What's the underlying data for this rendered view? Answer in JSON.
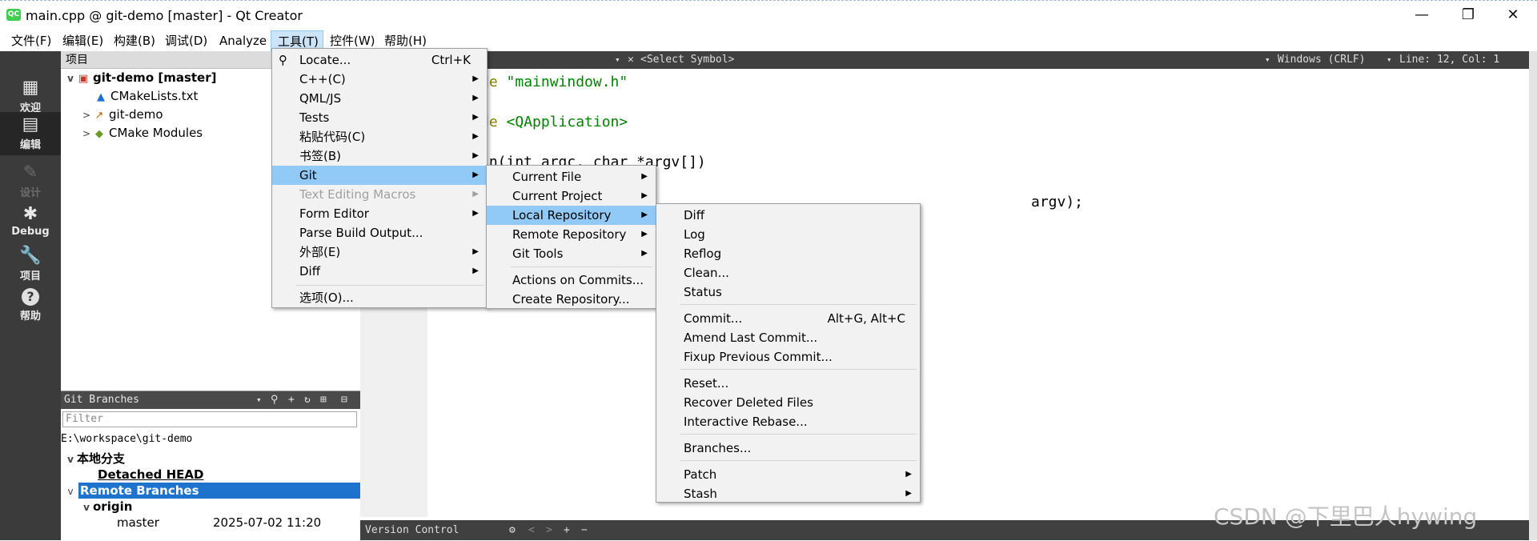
{
  "window": {
    "title": "main.cpp @ git-demo [master] - Qt Creator",
    "app_icon_text": "QC",
    "minimize": "—",
    "maximize": "❐",
    "close": "✕"
  },
  "menubar": [
    "文件(F)",
    "编辑(E)",
    "构建(B)",
    "调试(D)",
    "Analyze",
    "工具(T)",
    "控件(W)",
    "帮助(H)"
  ],
  "modes": [
    {
      "label": "欢迎",
      "icon": "grid-icon",
      "glyph": "▦"
    },
    {
      "label": "编辑",
      "icon": "edit-icon",
      "glyph": "▤"
    },
    {
      "label": "设计",
      "icon": "pencil-icon",
      "glyph": "✎"
    },
    {
      "label": "Debug",
      "icon": "bug-icon",
      "glyph": "✱"
    },
    {
      "label": "项目",
      "icon": "wrench-icon",
      "glyph": "🔧"
    },
    {
      "label": "帮助",
      "icon": "help-icon",
      "glyph": "?"
    }
  ],
  "project": {
    "header": "项目",
    "tree": [
      {
        "label": "git-demo [master]",
        "bold": true
      },
      {
        "label": "CMakeLists.txt"
      },
      {
        "label": "git-demo"
      },
      {
        "label": "CMake Modules"
      }
    ]
  },
  "git_branches": {
    "title": "Git Branches",
    "filter_placeholder": "Filter",
    "repo_path": "E:\\workspace\\git-demo",
    "local_group": "本地分支",
    "local_head": "Detached HEAD",
    "remote_group": "Remote Branches",
    "remote_name": "origin",
    "branch_name": "master",
    "branch_date": "2025-07-02 11:20"
  },
  "editor": {
    "symbol": "<Select Symbol>",
    "line_ending": "Windows (CRLF)",
    "position": "Line: 12, Col: 1",
    "code": [
      {
        "pre": "de ",
        "str": "\"mainwindow.h\"",
        "post": ""
      },
      {
        "pre": "de ",
        "str": "<QApplication>",
        "post": ""
      },
      {
        "pre": "in(int argc, char *argv[])",
        "str": "",
        "post": ""
      },
      {
        "pre": "argv);",
        "str": "",
        "post": ""
      }
    ]
  },
  "bottom_bar": {
    "label": "Version Control"
  },
  "tools_menu": [
    {
      "label": "Locate...",
      "shortcut": "Ctrl+K"
    },
    {
      "label": "C++(C)",
      "submenu": true
    },
    {
      "label": "QML/JS",
      "submenu": true
    },
    {
      "label": "Tests",
      "submenu": true
    },
    {
      "label": "粘贴代码(C)",
      "submenu": true
    },
    {
      "label": "书签(B)",
      "submenu": true
    },
    {
      "label": "Git",
      "submenu": true
    },
    {
      "label": "Text Editing Macros",
      "submenu": true
    },
    {
      "label": "Form Editor",
      "submenu": true
    },
    {
      "label": "Parse Build Output..."
    },
    {
      "label": "外部(E)",
      "submenu": true
    },
    {
      "label": "Diff",
      "submenu": true
    },
    {
      "label": "选项(O)..."
    }
  ],
  "git_menu": [
    {
      "label": "Current File",
      "submenu": true
    },
    {
      "label": "Current Project",
      "submenu": true
    },
    {
      "label": "Local Repository",
      "submenu": true
    },
    {
      "label": "Remote Repository",
      "submenu": true
    },
    {
      "label": "Git Tools",
      "submenu": true
    },
    {
      "label": "Actions on Commits..."
    },
    {
      "label": "Create Repository..."
    }
  ],
  "local_repo_menu": [
    {
      "label": "Diff"
    },
    {
      "label": "Log"
    },
    {
      "label": "Reflog"
    },
    {
      "label": "Clean..."
    },
    {
      "label": "Status"
    },
    {
      "label": "Commit...",
      "shortcut": "Alt+G, Alt+C"
    },
    {
      "label": "Amend Last Commit..."
    },
    {
      "label": "Fixup Previous Commit..."
    },
    {
      "label": "Reset..."
    },
    {
      "label": "Recover Deleted Files"
    },
    {
      "label": "Interactive Rebase..."
    },
    {
      "label": "Branches..."
    },
    {
      "label": "Patch",
      "submenu": true
    },
    {
      "label": "Stash",
      "submenu": true
    }
  ],
  "watermark": "CSDN @下里巴人hywing",
  "colors": {
    "highlight": "#91c9f7",
    "selection": "#1e73cc",
    "string": "#008000",
    "keyword": "#808000"
  }
}
